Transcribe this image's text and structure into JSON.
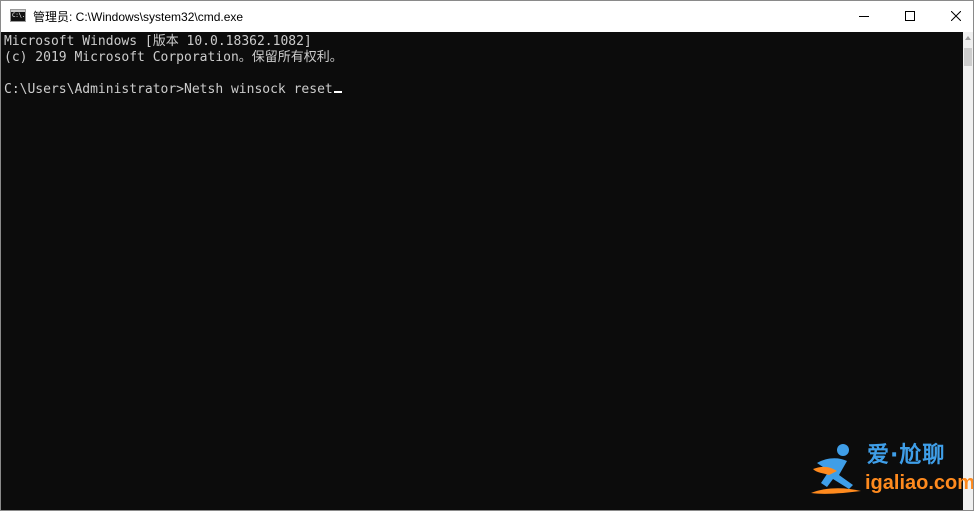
{
  "window": {
    "title": "管理员: C:\\Windows\\system32\\cmd.exe",
    "app_icon_text": "C:\\."
  },
  "console": {
    "lines": [
      "Microsoft Windows [版本 10.0.18362.1082]",
      "(c) 2019 Microsoft Corporation。保留所有权利。",
      "",
      "C:\\Users\\Administrator>Netsh winsock reset"
    ],
    "background": "#0c0c0c",
    "foreground": "#cccccc"
  },
  "caption_buttons": {
    "minimize_icon": "minimize-icon",
    "maximize_icon": "maximize-icon",
    "close_icon": "close-icon"
  },
  "watermark": {
    "brand_cn": "爱·尬聊",
    "url": "igaliao.com",
    "primary_color": "#3f9ee8",
    "accent_color": "#ff8a1e"
  }
}
